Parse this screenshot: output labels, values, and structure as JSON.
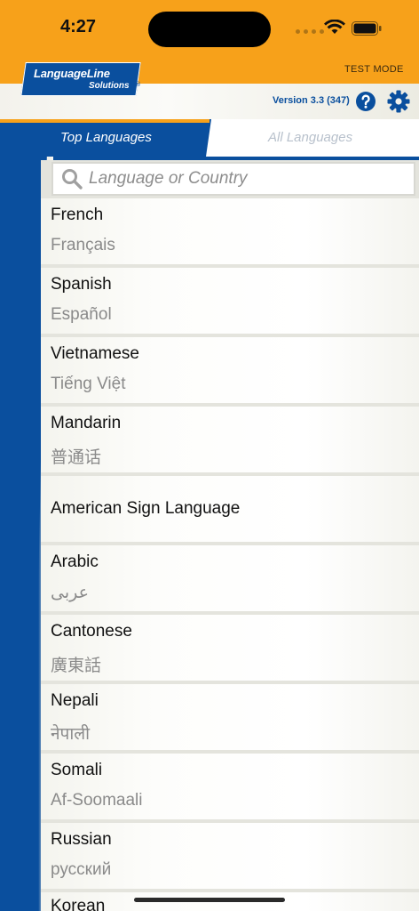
{
  "status_bar": {
    "time": "4:27"
  },
  "header": {
    "logo_line1": "LanguageLine",
    "logo_line2": "Solutions",
    "logo_reg": "®",
    "test_mode": "TEST MODE",
    "version": "Version 3.3 (347)"
  },
  "tabs": [
    {
      "label": "Top Languages",
      "selected": true
    },
    {
      "label": "All Languages",
      "selected": false
    }
  ],
  "search": {
    "placeholder": "Language or Country"
  },
  "languages": [
    {
      "name": "French",
      "native": "Français"
    },
    {
      "name": "Spanish",
      "native": "Español"
    },
    {
      "name": "Vietnamese",
      "native": "Tiếng Việt"
    },
    {
      "name": "Mandarin",
      "native": "普通话"
    },
    {
      "name": "American Sign Language",
      "native": ""
    },
    {
      "name": "Arabic",
      "native": "عربى"
    },
    {
      "name": "Cantonese",
      "native": "廣東話"
    },
    {
      "name": "Nepali",
      "native": "नेपाली"
    },
    {
      "name": "Somali",
      "native": "Af-Soomaali"
    },
    {
      "name": "Russian",
      "native": "русский"
    },
    {
      "name": "Korean",
      "native": ""
    }
  ],
  "colors": {
    "brand_blue": "#0a4f9e",
    "brand_orange": "#f7a11a"
  }
}
